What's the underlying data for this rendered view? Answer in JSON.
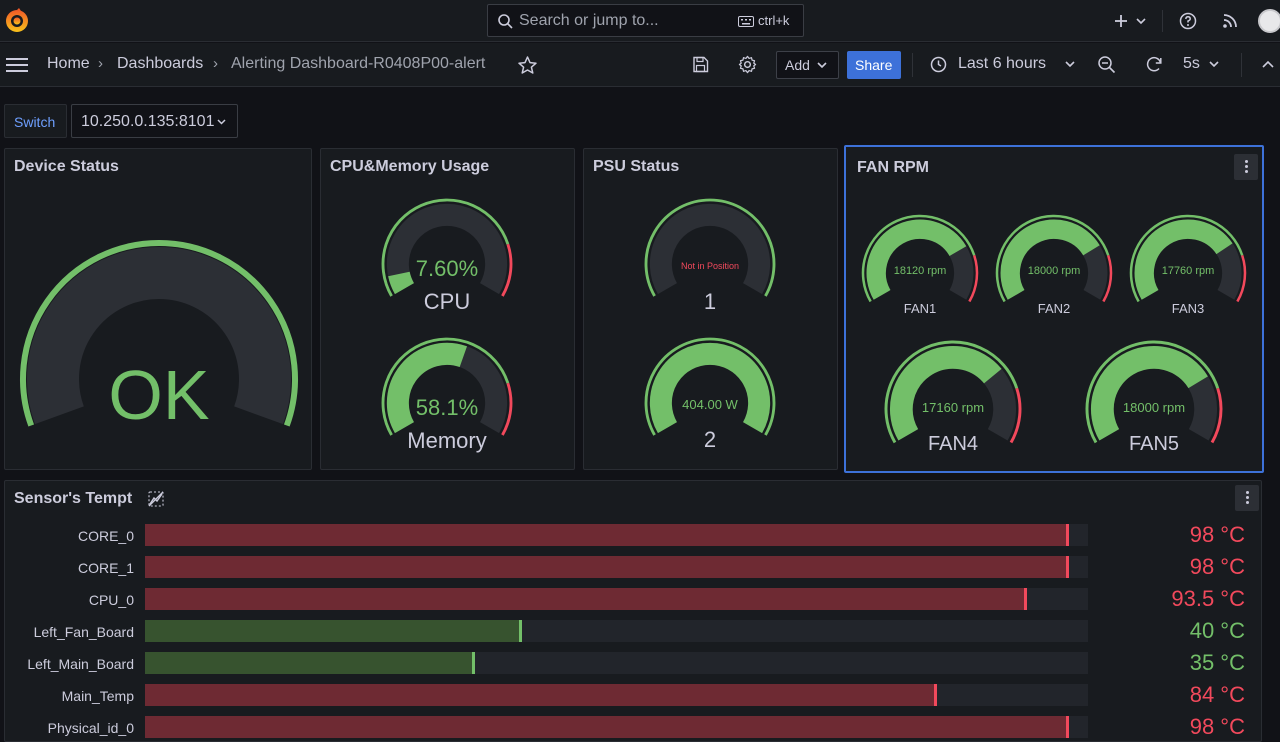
{
  "topbar": {
    "search_placeholder": "Search or jump to...",
    "search_shortcut": "ctrl+k",
    "icons": [
      "grafana-logo-icon",
      "search-icon",
      "keyboard-icon",
      "plus-icon",
      "chevron-down-icon",
      "help-icon",
      "rss-icon",
      "avatar"
    ]
  },
  "navbar": {
    "breadcrumb": [
      "Home",
      "Dashboards",
      "Alerting Dashboard-R0408P00-alert"
    ],
    "add_label": "Add",
    "share_label": "Share",
    "time_range": "Last 6 hours",
    "refresh_interval": "5s"
  },
  "variables": {
    "label": "Switch",
    "value": "10.250.0.135:8101"
  },
  "panels": {
    "device_status": {
      "title": "Device Status",
      "value": "OK",
      "fraction": 1.0
    },
    "cpu_memory": {
      "title": "CPU&Memory Usage",
      "gauges": [
        {
          "name": "CPU",
          "value": "7.60%",
          "fraction": 0.076
        },
        {
          "name": "Memory",
          "value": "58.1%",
          "fraction": 0.581
        }
      ]
    },
    "psu": {
      "title": "PSU Status",
      "gauges": [
        {
          "name": "1",
          "value": "Not in Position",
          "fraction": 0.0,
          "status": "bad"
        },
        {
          "name": "2",
          "value": "404.00 W",
          "fraction": 1.0,
          "status": "ok"
        }
      ]
    },
    "fan": {
      "title": "FAN RPM",
      "gauges": [
        {
          "name": "FAN1",
          "value": "18120 rpm",
          "fraction": 0.75
        },
        {
          "name": "FAN2",
          "value": "18000 rpm",
          "fraction": 0.745
        },
        {
          "name": "FAN3",
          "value": "17760 rpm",
          "fraction": 0.735
        },
        {
          "name": "FAN4",
          "value": "17160 rpm",
          "fraction": 0.71
        },
        {
          "name": "FAN5",
          "value": "18000 rpm",
          "fraction": 0.745
        }
      ]
    },
    "sensors": {
      "title": "Sensor's Tempt",
      "rows": [
        {
          "label": "CORE_0",
          "value": "98 °C",
          "temp": 98,
          "fraction": 0.98,
          "status": "hot"
        },
        {
          "label": "CORE_1",
          "value": "98 °C",
          "temp": 98,
          "fraction": 0.98,
          "status": "hot"
        },
        {
          "label": "CPU_0",
          "value": "93.5 °C",
          "temp": 93.5,
          "fraction": 0.935,
          "status": "hot"
        },
        {
          "label": "Left_Fan_Board",
          "value": "40 °C",
          "temp": 40,
          "fraction": 0.4,
          "status": "ok"
        },
        {
          "label": "Left_Main_Board",
          "value": "35 °C",
          "temp": 35,
          "fraction": 0.35,
          "status": "ok"
        },
        {
          "label": "Main_Temp",
          "value": "84 °C",
          "temp": 84,
          "fraction": 0.84,
          "status": "hot"
        },
        {
          "label": "Physical_id_0",
          "value": "98 °C",
          "temp": 98,
          "fraction": 0.98,
          "status": "hot"
        }
      ]
    }
  },
  "colors": {
    "ok_green": "#73bf69",
    "alert_red": "#f2495c",
    "track": "#2c2f35",
    "accent_blue": "#3d71d9",
    "bar_red": "#6e2a33",
    "bar_green": "#37532f"
  }
}
